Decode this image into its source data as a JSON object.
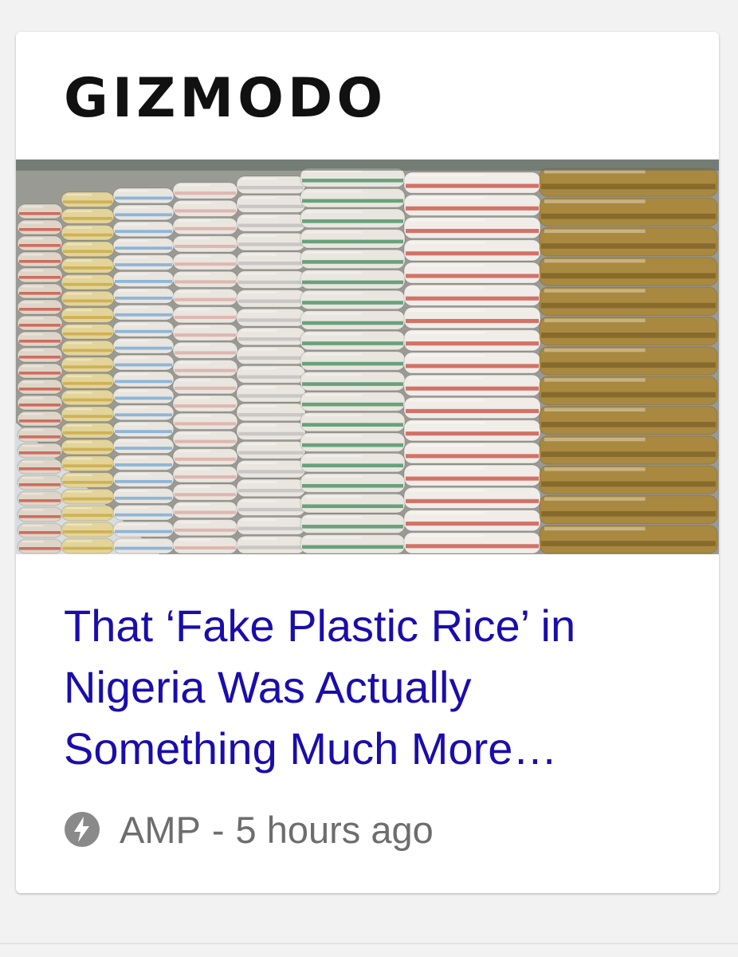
{
  "card": {
    "publisher": "GIZMODO",
    "image": {
      "subject": "rice-bags-image",
      "colors": {
        "background": "#9a9a94",
        "white_bags": "#e9e5df",
        "gold_bags": "#a9893f",
        "green_stripe": "#3c8a5a",
        "blue_stripe": "#6ea6d6",
        "red_stripe": "#c84a3c"
      }
    },
    "headline": "That ‘Fake Plastic Rice’ in Nigeria Was Actually Something Much More…",
    "meta": {
      "icon": "amp-lightning-icon",
      "label": "AMP",
      "separator": "-",
      "time": "5 hours ago"
    }
  },
  "colors": {
    "page_background": "#f2f2f2",
    "card_background": "#ffffff",
    "headline": "#1a0dab",
    "meta_text": "#6d6d6d",
    "logo": "#111111"
  }
}
